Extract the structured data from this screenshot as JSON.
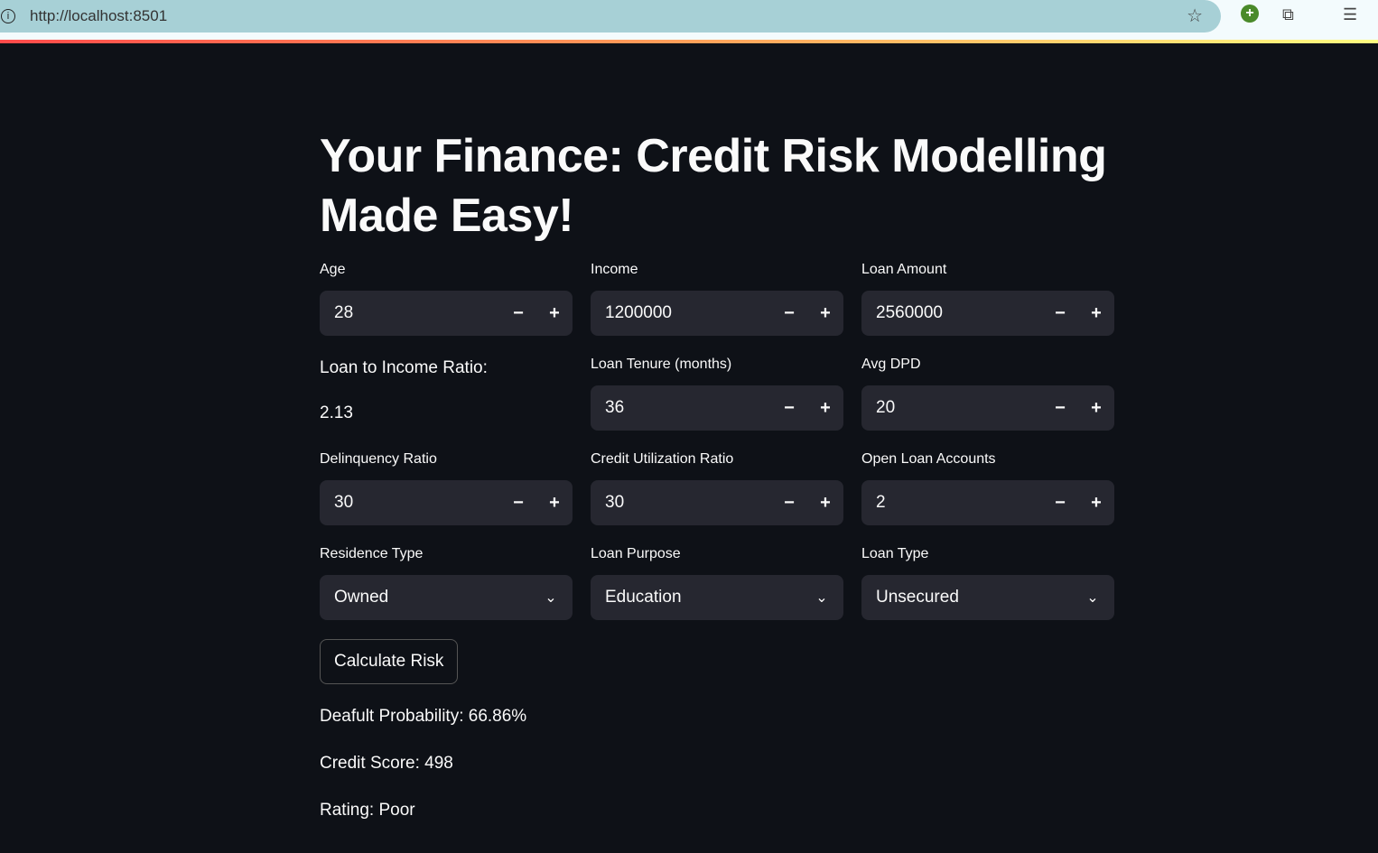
{
  "browser": {
    "url": "http://localhost:8501"
  },
  "title": "Your Finance: Credit Risk Modelling Made Easy!",
  "fields": {
    "age": {
      "label": "Age",
      "value": "28"
    },
    "income": {
      "label": "Income",
      "value": "1200000"
    },
    "loan_amount": {
      "label": "Loan Amount",
      "value": "2560000"
    },
    "lti": {
      "label": "Loan to Income Ratio:",
      "value": "2.13"
    },
    "tenure": {
      "label": "Loan Tenure (months)",
      "value": "36"
    },
    "dpd": {
      "label": "Avg DPD",
      "value": "20"
    },
    "delinquency": {
      "label": "Delinquency Ratio",
      "value": "30"
    },
    "credit_util": {
      "label": "Credit Utilization Ratio",
      "value": "30"
    },
    "open_loans": {
      "label": "Open Loan Accounts",
      "value": "2"
    },
    "residence": {
      "label": "Residence Type",
      "value": "Owned"
    },
    "purpose": {
      "label": "Loan Purpose",
      "value": "Education"
    },
    "loan_type": {
      "label": "Loan Type",
      "value": "Unsecured"
    }
  },
  "calculate_label": "Calculate Risk",
  "results": {
    "probability": "Deafult Probability: 66.86%",
    "score": "Credit Score: 498",
    "rating": "Rating: Poor"
  }
}
